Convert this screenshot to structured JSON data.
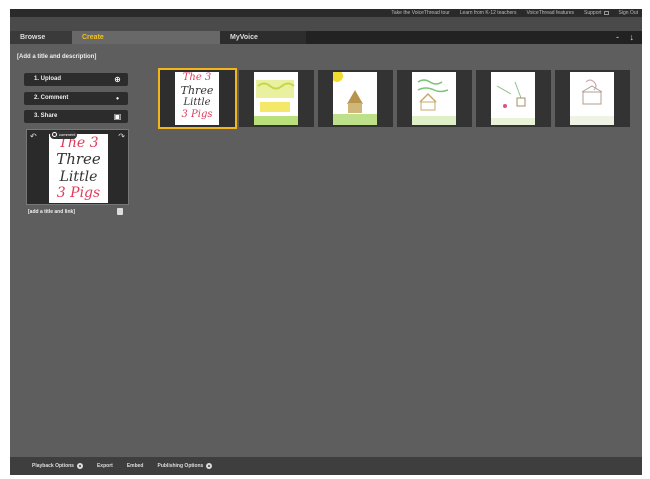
{
  "top_links": [
    {
      "label": "Take the VoiceThread tour"
    },
    {
      "label": "Learn from K-12 teachers"
    },
    {
      "label": "VoiceThread features"
    },
    {
      "label": "Support"
    },
    {
      "label": "Sign Out"
    }
  ],
  "tabs": {
    "browse": "Browse",
    "create": "Create",
    "myvoice": "MyVoice"
  },
  "tab_icons": {
    "minus": "-",
    "menu": "↓"
  },
  "create": {
    "title_hint": "[Add a title and description]",
    "steps": [
      {
        "label": "1. Upload",
        "icon": "plus-circle-icon",
        "glyph": "⊕"
      },
      {
        "label": "2. Comment",
        "icon": "microphone-icon",
        "glyph": "•"
      },
      {
        "label": "3. Share",
        "icon": "share-box-icon",
        "glyph": "▣"
      }
    ],
    "preview": {
      "badge": "comment",
      "lines": [
        "The 3",
        "Three",
        "Little",
        "3 Pigs"
      ],
      "add_title_link": "[add a title and link]"
    }
  },
  "filmstrip": [
    {
      "selected": true,
      "lines": [
        "The 3",
        "Three",
        "Little",
        "3 Pigs"
      ]
    },
    {
      "selected": false
    },
    {
      "selected": false
    },
    {
      "selected": false
    },
    {
      "selected": false
    },
    {
      "selected": false
    }
  ],
  "bottom_bar": {
    "playback_options": "Playback Options",
    "export": "Export",
    "embed": "Embed",
    "publishing_options": "Publishing Options"
  },
  "colors": {
    "accent": "#f3b51a",
    "background": "#5e5e5e",
    "ink_red": "#e23a5b"
  }
}
